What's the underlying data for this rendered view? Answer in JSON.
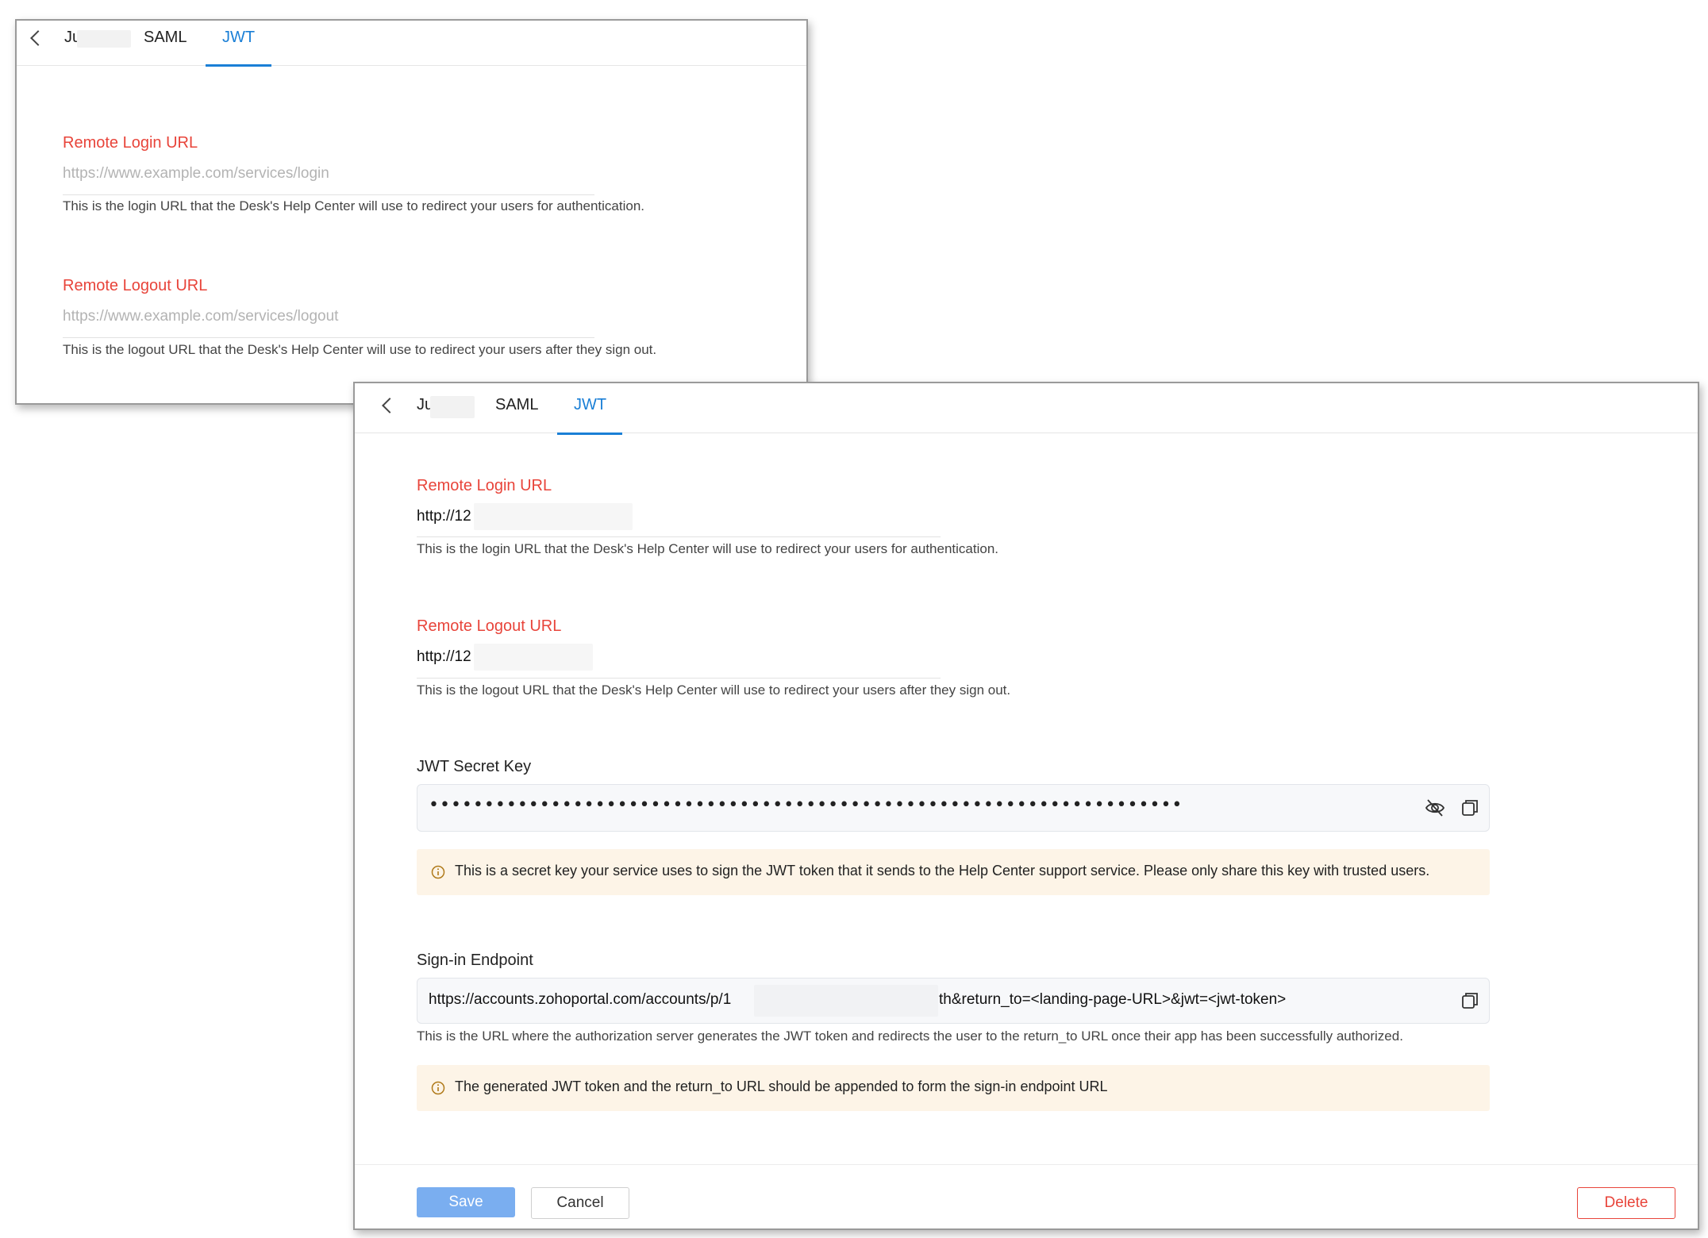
{
  "back_panel": {
    "tabs": [
      {
        "label": "Ju"
      },
      {
        "label": "SAML"
      },
      {
        "label": "JWT",
        "active": true
      }
    ],
    "login": {
      "label": "Remote Login URL",
      "placeholder": "https://www.example.com/services/login",
      "help": "This is the login URL that the Desk's Help Center will use to redirect your users for authentication."
    },
    "logout": {
      "label": "Remote Logout URL",
      "placeholder": "https://www.example.com/services/logout",
      "help": "This is the logout URL that the Desk's Help Center will use to redirect your users after they sign out."
    }
  },
  "front_panel": {
    "tabs": [
      {
        "label": "Ju"
      },
      {
        "label": "SAML"
      },
      {
        "label": "JWT",
        "active": true
      }
    ],
    "login": {
      "label": "Remote Login URL",
      "value": "http://12",
      "help": "This is the login URL that the Desk's Help Center will use to redirect your users for authentication."
    },
    "logout": {
      "label": "Remote Logout URL",
      "value": "http://12",
      "help": "This is the logout URL that the Desk's Help Center will use to redirect your users after they sign out."
    },
    "secret": {
      "label": "JWT Secret Key",
      "masked_value": "••••••••••••••••••••••••••••••••••••••••••••••••••••••••••••••••••••",
      "note": "This is a secret key your service uses to sign the JWT token that it sends to the Help Center support service. Please only share this key with trusted users."
    },
    "endpoint": {
      "label": "Sign-in Endpoint",
      "value_start": "https://accounts.zohoportal.com/accounts/p/1",
      "value_end": "th&return_to=<landing-page-URL>&jwt=<jwt-token>",
      "help": "This is the URL where the authorization server generates the JWT token and redirects the user to the return_to URL once their app has been successfully authorized.",
      "note": "The generated JWT token and the return_to URL should be appended to form the sign-in endpoint URL"
    },
    "buttons": {
      "save": "Save",
      "cancel": "Cancel",
      "delete": "Delete"
    }
  },
  "colors": {
    "accent": "#1a7fd6",
    "label_red": "#e8443a",
    "note_bg": "#fdf4e7",
    "save_bg": "#7aaef0"
  }
}
